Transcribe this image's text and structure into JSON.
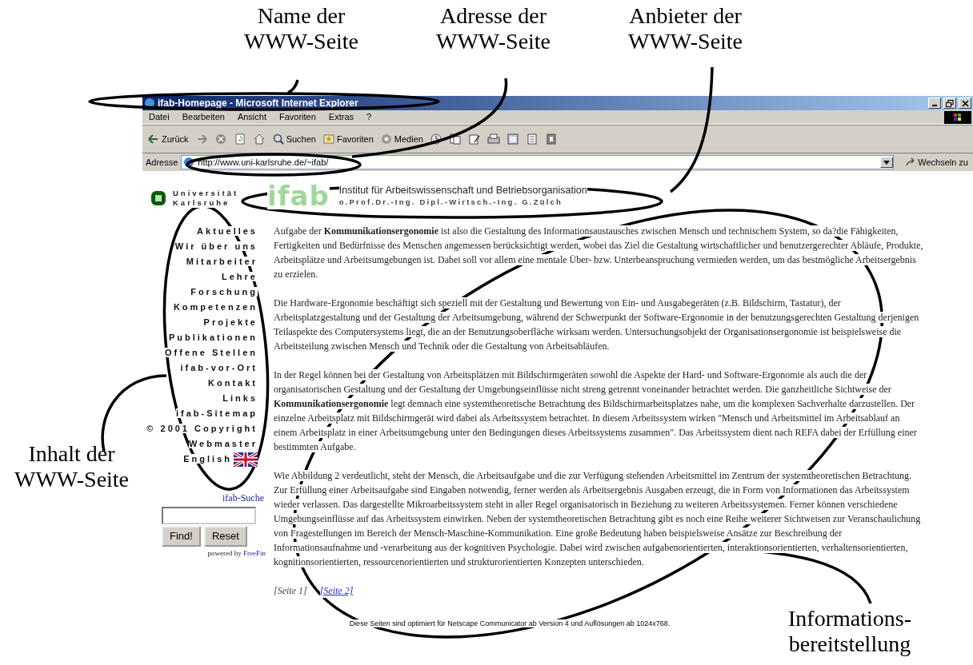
{
  "callouts": [
    {
      "lines": [
        "Name der",
        "WWW-Seite"
      ]
    },
    {
      "lines": [
        "Adresse der",
        "WWW-Seite"
      ]
    },
    {
      "lines": [
        "Anbieter der",
        "WWW-Seite"
      ]
    },
    {
      "lines": [
        "Inhalt der",
        "WWW-Seite"
      ]
    },
    {
      "lines": [
        "Informations-",
        "bereitstellung"
      ]
    }
  ],
  "window": {
    "title": "ifab-Homepage - Microsoft Internet Explorer"
  },
  "menu": [
    "Datei",
    "Bearbeiten",
    "Ansicht",
    "Favoriten",
    "Extras",
    "?"
  ],
  "toolbar": [
    {
      "kind": "back",
      "label": "Zurück"
    },
    {
      "kind": "forward"
    },
    {
      "kind": "stop"
    },
    {
      "kind": "refresh"
    },
    {
      "kind": "home"
    },
    {
      "kind": "search",
      "label": "Suchen"
    },
    {
      "kind": "favorites",
      "label": "Favoriten"
    },
    {
      "kind": "media",
      "label": "Medien"
    },
    {
      "kind": "history"
    },
    {
      "kind": "mail"
    },
    {
      "kind": "edit"
    },
    {
      "kind": "print"
    },
    {
      "kind": "window"
    },
    {
      "kind": "document"
    },
    {
      "kind": "book"
    }
  ],
  "address": {
    "label": "Adresse",
    "url": "http://www.uni-karlsruhe.de/~ifab/",
    "go": "Wechseln zu"
  },
  "header": {
    "university": [
      "Universität",
      "Karlsruhe"
    ],
    "logo": "ifab",
    "institute": "Institut für Arbeitswissenschaft und Betriebsorganisation",
    "professor": "o.Prof.Dr.-Ing. Dipl.-Wirtsch.-Ing. G.Zülch"
  },
  "nav": [
    {
      "label": "Aktuelles"
    },
    {
      "label": "Wir über uns"
    },
    {
      "label": "Mitarbeiter"
    },
    {
      "label": "Lehre"
    },
    {
      "label": "Forschung"
    },
    {
      "label": "Kompetenzen"
    },
    {
      "label": "Projekte"
    },
    {
      "label": "Publikationen"
    },
    {
      "label": "Offene Stellen"
    },
    {
      "label": "ifab-vor-Ort"
    },
    {
      "label": "Kontakt"
    },
    {
      "label": "Links"
    },
    {
      "label": "ifab-Sitemap"
    },
    {
      "label": "© 2001 Copyright"
    },
    {
      "label": "Webmaster"
    },
    {
      "label": "English",
      "flag": true
    }
  ],
  "search": {
    "title": "ifab-Suche",
    "find": "Find!",
    "reset": "Reset",
    "powered": "powered by",
    "provider": "FreeFin"
  },
  "paragraphs": [
    "Aufgabe der **Kommunikationsergonomie** ist also die Gestaltung des Informationsaustausches zwischen Mensch und technischem System, so da?die Fähigkeiten, Fertigkeiten und Bedürfnisse des Menschen angemessen berücksichtigt werden, wobei das Ziel die Gestaltung wirtschaftlicher und benutzergerechter Abläufe, Produkte, Arbeitsplätze und Arbeitsumgebungen ist. Dabei soll vor allem eine mentale Über- bzw. Unterbeanspruchung vermieden werden, um das bestmögliche Arbeitsergebnis zu erzielen.",
    "Die Hardware-Ergonomie beschäftigt sich speziell mit der Gestaltung und Bewertung von Ein- und Ausgabegeräten (z.B. Bildschirm, Tastatur), der Arbeitsplatzgestaltung und der Gestaltung der Arbeitsumgebung, während der Schwerpunkt der Software-Ergonomie in der benutzungsgerechten Gestaltung derjenigen Teilaspekte des Computersystems liegt, die an der Benutzungsoberfläche wirksam werden. Untersuchungsobjekt der Organisationsergonomie ist beispielsweise die Arbeitsteilung zwischen Mensch und Technik oder die Gestaltung von Arbeitsabläufen.",
    "In der Regel können bei der Gestaltung von Arbeitsplätzen mit Bildschirmgeräten sowohl die Aspekte der Hard- und Software-Ergonomie als auch die der organisatorischen Gestaltung und der Gestaltung der Umgebungseinflüsse nicht streng getrennt voneinander betrachtet werden. Die ganzheitliche Sichtweise der **Kommunikationsergonomie** legt demnach eine systemtheoretische Betrachtung des Bildschirmarbeitsplatzes nahe, um die komplexen Sachverhalte darzustellen. Der einzelne Arbeitsplatz mit Bildschirmgerät wird dabei als Arbeitssystem betrachtet. In diesem Arbeitssystem wirken \"Mensch und Arbeitsmittel im Arbeitsablauf an einem Arbeitsplatz in einer Arbeitsumgebung unter den Bedingungen dieses Arbeitssystems zusammen\". Das Arbeitssystem dient nach REFA dabei der Erfüllung einer bestimmten Aufgabe.",
    "Wie Abbildung 2 verdeutlicht, steht der Mensch, die Arbeitsaufgabe und die zur Verfügung stehenden Arbeitsmittel im Zentrum der systemtheoretischen Betrachtung. Zur Erfüllung einer Arbeitsaufgabe sind Eingaben notwendig, ferner werden als Arbeitsergebnis Ausgaben erzeugt, die in Form von Informationen das Arbeitssystem wieder verlassen. Das dargestellte Mikroarbeitssystem steht in aller Regel organisatorisch in Beziehung zu weiteren Arbeitssystemen. Ferner können verschiedene Umgebungseinflüsse auf das Arbeitssystem einwirken. Neben der systemtheoretischen Betrachtung gibt es noch eine Reihe weiterer Sichtweisen zur Veranschaulichung von Fragestellungen im Bereich der Mensch-Maschine-Kommunikation. Eine große Bedeutung haben beispielsweise Ansätze zur Beschreibung der Informationsaufnahme und -verarbeitung aus der kognitiven Psychologie. Dabei wird zwischen aufgabenorientierten, interaktionsorientierten, verhaltensorientierten, kognitionsorientierten, ressourcenorientierten und strukturorientierten Konzepten unterschieden."
  ],
  "pages": [
    {
      "label": "[Seite 1]",
      "selected": true
    },
    {
      "label": "[Seite 2]",
      "selected": false
    }
  ],
  "footer": "Diese Seiten sind optimiert für Netscape Communicator ab Version 4 und Auflösungen ab 1024x768."
}
